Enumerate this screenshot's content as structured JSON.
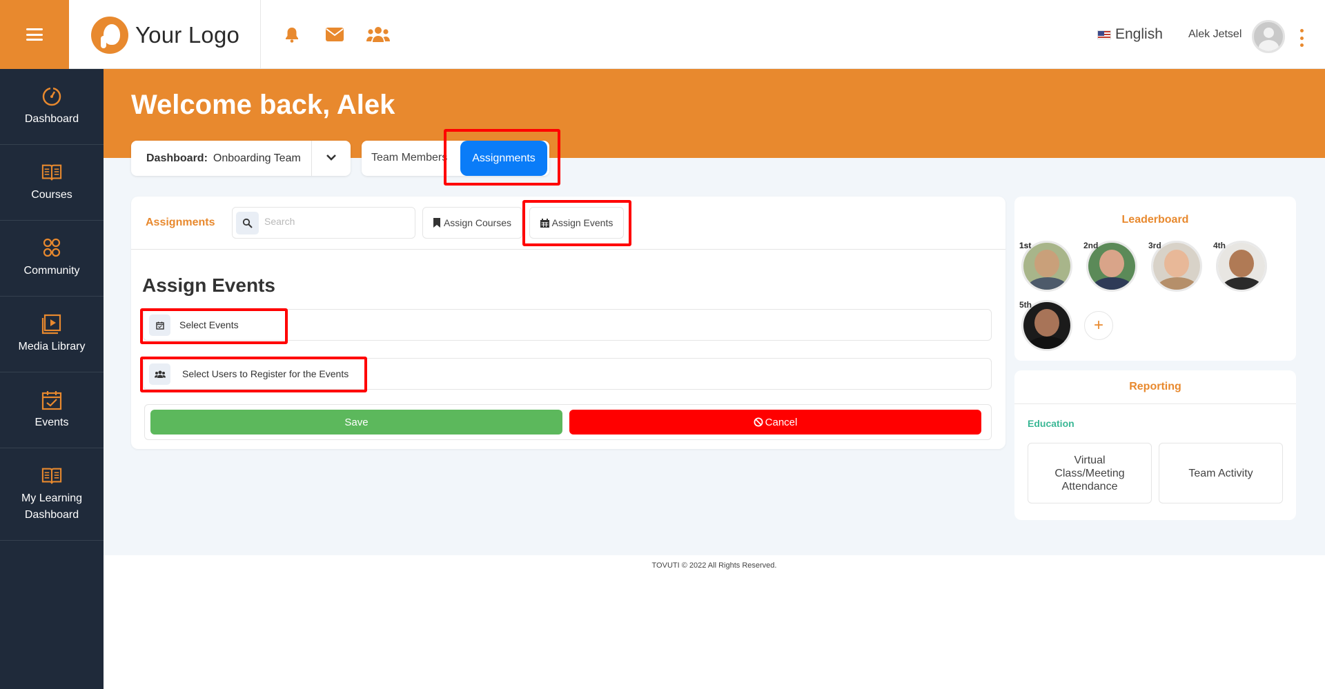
{
  "header": {
    "logo_text": "Your Logo",
    "language": "English",
    "username": "Alek Jetsel",
    "icons": [
      "bell-icon",
      "envelope-icon",
      "users-icon"
    ]
  },
  "sidebar": {
    "items": [
      {
        "label": "Dashboard",
        "icon": "dashboard-gauge-icon"
      },
      {
        "label": "Courses",
        "icon": "book-icon"
      },
      {
        "label": "Community",
        "icon": "community-icon"
      },
      {
        "label": "Media Library",
        "icon": "media-library-icon"
      },
      {
        "label": "Events",
        "icon": "calendar-icon"
      },
      {
        "label": "My Learning Dashboard",
        "icon": "open-book-icon"
      }
    ]
  },
  "hero": {
    "title": "Welcome back, Alek"
  },
  "dashboard_select": {
    "label": "Dashboard:",
    "value": "Onboarding Team"
  },
  "tabs": {
    "members": "Team Members",
    "assignments": "Assignments"
  },
  "assignments_card": {
    "title": "Assignments",
    "search_placeholder": "Search",
    "assign_courses": "Assign Courses",
    "assign_events": "Assign Events",
    "section_title": "Assign Events",
    "select_events": "Select Events",
    "select_users": "Select Users to Register for the Events",
    "save": "Save",
    "cancel": "Cancel"
  },
  "leaderboard": {
    "title": "Leaderboard",
    "ranks": [
      "1st",
      "2nd",
      "3rd",
      "4th",
      "5th"
    ]
  },
  "reporting": {
    "title": "Reporting",
    "section": "Education",
    "tiles": [
      "Virtual Class/Meeting Attendance",
      "Team Activity"
    ]
  },
  "footer": {
    "text": "TOVUTI © 2022 All Rights Reserved."
  },
  "colors": {
    "brand_orange": "#e8892e",
    "sidebar_navy": "#1f2a3a",
    "primary_blue": "#0a7cf8",
    "save_green": "#5cb85c",
    "cancel_red": "#ff0000",
    "highlight_red": "#ff0000"
  }
}
